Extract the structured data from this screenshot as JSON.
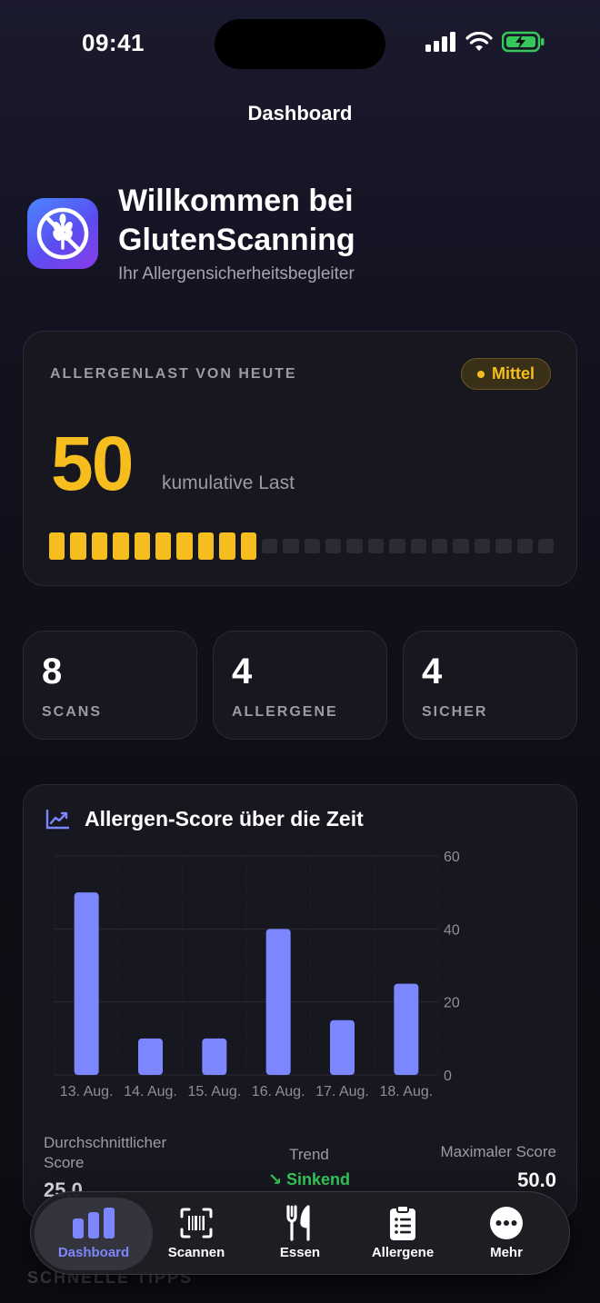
{
  "status": {
    "time": "09:41"
  },
  "nav": {
    "title": "Dashboard"
  },
  "header": {
    "title": "Willkommen bei GlutenScanning",
    "subtitle": "Ihr Allergensicherheitsbegleiter"
  },
  "load": {
    "title": "ALLERGENLAST VON HEUTE",
    "badge": "Mittel",
    "value": "50",
    "caption": "kumulative Last",
    "filled_segments": 10,
    "total_segments": 24
  },
  "stats": [
    {
      "value": "8",
      "label": "SCANS"
    },
    {
      "value": "4",
      "label": "ALLERGENE"
    },
    {
      "value": "4",
      "label": "SICHER"
    }
  ],
  "chart_section": {
    "title": "Allergen-Score über die Zeit",
    "avg_label": "Durchschnittlicher Score",
    "avg_value": "25.0",
    "trend_label": "Trend",
    "trend_value": "↘ Sinkend",
    "max_label": "Maximaler Score",
    "max_value": "50.0"
  },
  "chart_data": {
    "type": "bar",
    "title": "Allergen-Score über die Zeit",
    "categories": [
      "13. Aug.",
      "14. Aug.",
      "15. Aug.",
      "16. Aug.",
      "17. Aug.",
      "18. Aug."
    ],
    "values": [
      50,
      10,
      10,
      40,
      15,
      25
    ],
    "ylim": [
      0,
      60
    ],
    "yticks": [
      0,
      20,
      40,
      60
    ],
    "grid": true,
    "color": "#7b86ff"
  },
  "tips_heading": "SCHNELLE TIPPS",
  "tabs": [
    {
      "label": "Dashboard",
      "icon": "chart-bar-icon",
      "active": true
    },
    {
      "label": "Scannen",
      "icon": "barcode-scan-icon"
    },
    {
      "label": "Essen",
      "icon": "fork-knife-icon"
    },
    {
      "label": "Allergene",
      "icon": "clipboard-list-icon"
    },
    {
      "label": "Mehr",
      "icon": "ellipsis-circle-icon"
    }
  ],
  "colors": {
    "accent": "#7b86ff",
    "warning": "#f5be1e",
    "success": "#34c759"
  }
}
